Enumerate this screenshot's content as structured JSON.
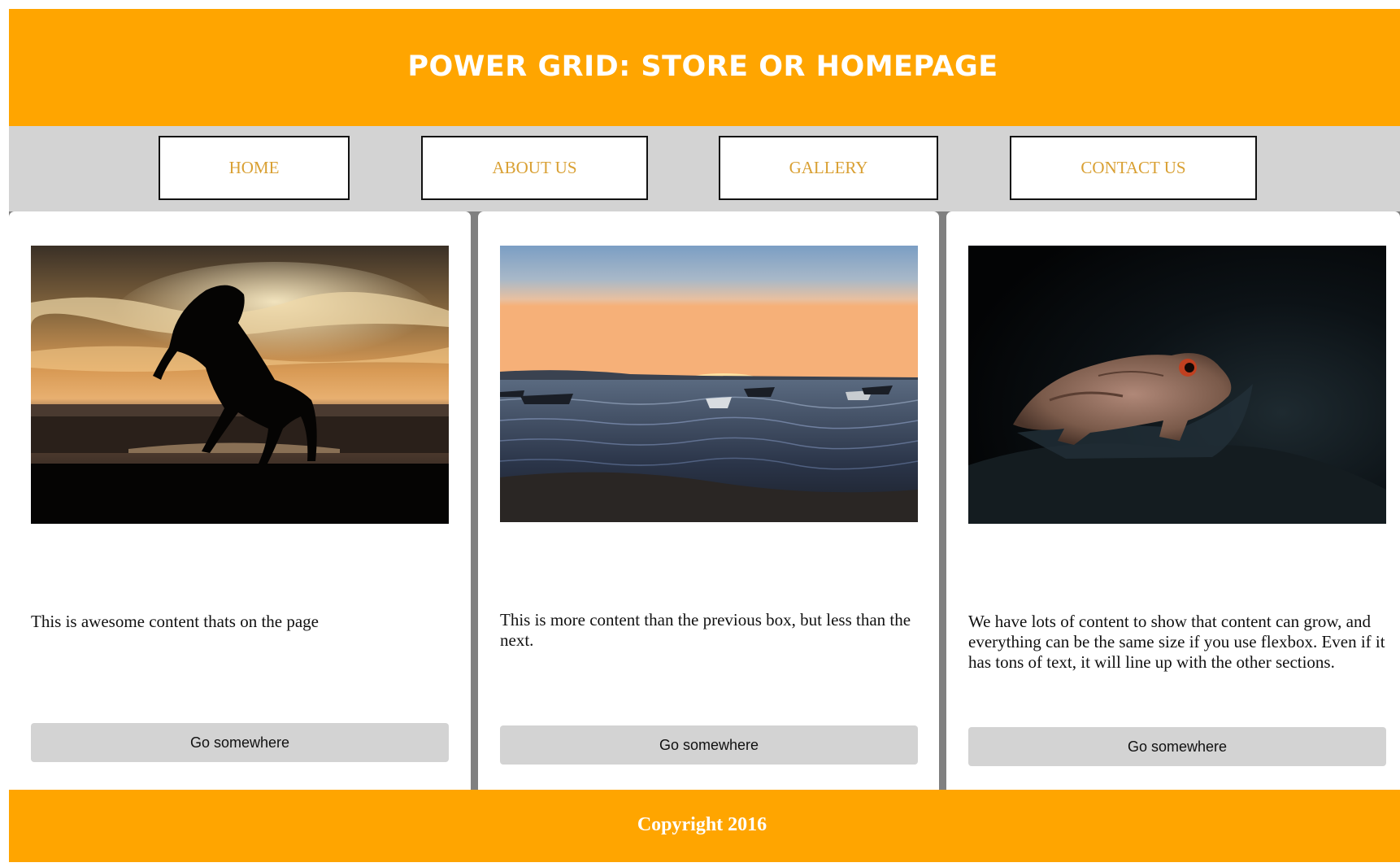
{
  "header": {
    "title": "POWER GRID: STORE OR HOMEPAGE"
  },
  "nav": {
    "items": [
      {
        "label": "HOME"
      },
      {
        "label": "ABOUT US"
      },
      {
        "label": "GALLERY"
      },
      {
        "label": "CONTACT US"
      }
    ]
  },
  "cards": [
    {
      "image": "horse-silhouette-sunset-photo",
      "text": "This is awesome content thats on the page",
      "button_label": "Go somewhere"
    },
    {
      "image": "boats-on-sea-sunset-photo",
      "text": "This is more content than the previous box, but less than the next.",
      "button_label": "Go somewhere"
    },
    {
      "image": "frog-closeup-photo",
      "text": "We have lots of content to show that content can grow, and everything can be the same size if you use flexbox. Even if it has tons of text, it will line up with the other sections.",
      "button_label": "Go somewhere"
    }
  ],
  "footer": {
    "copyright": "Copyright 2016"
  },
  "colors": {
    "accent": "#ffa500",
    "nav_background": "#d3d3d3",
    "nav_text": "#d9a033",
    "content_background": "#808080",
    "button_background": "#d3d3d3"
  }
}
